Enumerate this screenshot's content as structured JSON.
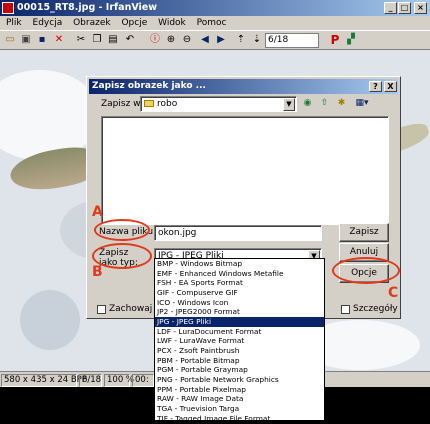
{
  "window": {
    "title": "00015_RT8.jpg - IrfanView"
  },
  "menu": [
    "Plik",
    "Edycja",
    "Obrazek",
    "Opcje",
    "Widok",
    "Pomoc"
  ],
  "toolbar": {
    "page": "6/18"
  },
  "status": {
    "dims": "580 x 435 x 24 BPP",
    "page": "6/18",
    "zoom": "100 %",
    "extra": "00:"
  },
  "dialog": {
    "title": "Zapisz obrazek jako ...",
    "help": "?",
    "close": "X",
    "save_in_label": "Zapisz w:",
    "save_in_value": "robo",
    "filename_label": "Nazwa pliku:",
    "filename_value": "okon.jpg",
    "filetype_label": "Zapisz jako typ:",
    "filetype_value": "JPG - JPEG Pliki",
    "save_button": "Zapisz",
    "cancel_button": "Anuluj",
    "options_button": "Opcje",
    "keep_label": "Zachowaj",
    "details_label": "Szczegóły"
  },
  "formats": [
    "BMP - Windows Bitmap",
    "EMF - Enhanced Windows Metafile",
    "FSH - EA Sports Format",
    "GIF - Compuserve GIF",
    "ICO - Windows Icon",
    "JP2 - JPEG2000 Format",
    "JPG - JPEG Pliki",
    "LDF - LuraDocument Format",
    "LWF - LuraWave Format",
    "PCX - Zsoft Paintbrush",
    "PBM - Portable Bitmap",
    "PGM - Portable Graymap",
    "PNG - Portable Network Graphics",
    "PPM - Portable Pixelmap",
    "RAW - RAW Image Data",
    "TGA - Truevision Targa",
    "TIF - Tagged Image File Format"
  ],
  "selected_format_index": 6,
  "annotations": {
    "a": "A",
    "b": "B",
    "c": "C"
  },
  "colors": {
    "annotation": "#e03a1a",
    "titlebar": "#0a246a",
    "selection": "#0a246a"
  }
}
